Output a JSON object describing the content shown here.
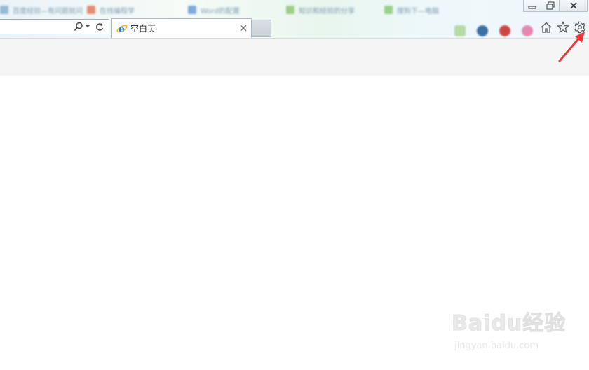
{
  "browser": {
    "background_tabs": [
      {
        "title": "百度经验—有问题就问",
        "color": "#7aa7c7"
      },
      {
        "title": "在线编程学",
        "color": "#e06a4a"
      },
      {
        "title": "Word的配置",
        "color": "#5b8fd0"
      },
      {
        "title": "知识和经验的分享",
        "color": "#86c06a"
      },
      {
        "title": "搜狗下—电脑",
        "color": "#7dc36a"
      }
    ],
    "address_bar": {
      "value": "",
      "placeholder": ""
    },
    "active_tab": {
      "title": "空白页",
      "icon": "ie-icon"
    },
    "toolbar": {
      "home": "home-icon",
      "favorites": "star-icon",
      "tools": "gear-icon"
    },
    "colors": {
      "accent_arrow": "#e8393a",
      "ie_blue": "#1e7fd3",
      "ie_gold": "#f3b31a"
    }
  },
  "watermark": {
    "logo": "Baidu经验",
    "url": "jingyan.baidu.com"
  }
}
